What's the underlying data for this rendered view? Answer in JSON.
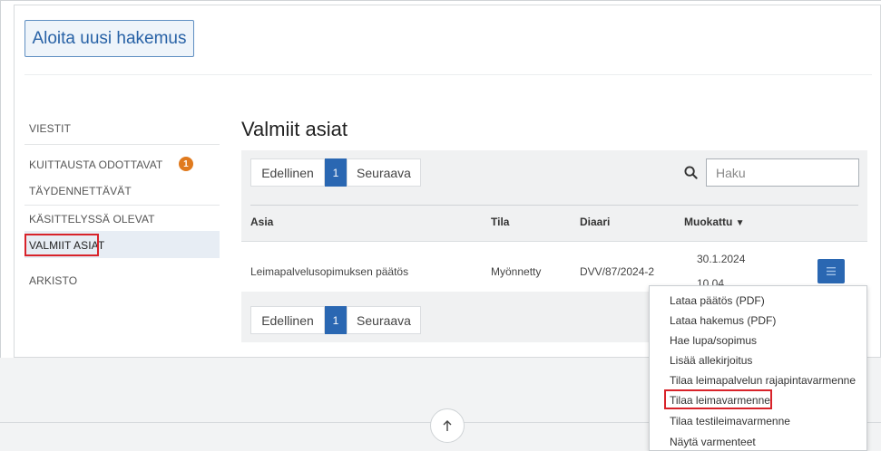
{
  "new_application_button": "Aloita uusi hakemus",
  "sidebar": {
    "items": [
      {
        "label": "VIESTIT"
      },
      {
        "label": "KUITTAUSTA ODOTTAVAT",
        "badge": "1"
      },
      {
        "label": "TÄYDENNETTÄVÄT"
      },
      {
        "label": "KÄSITTELYSSÄ OLEVAT"
      },
      {
        "label": "VALMIIT ASIAT",
        "active": true
      },
      {
        "label": "ARKISTO"
      }
    ]
  },
  "section_title": "Valmiit asiat",
  "pager": {
    "previous": "Edellinen",
    "current": "1",
    "next": "Seuraava"
  },
  "search": {
    "placeholder": "Haku",
    "icon": "search-icon"
  },
  "table": {
    "headers": {
      "asia": "Asia",
      "tila": "Tila",
      "diaari": "Diaari",
      "muokattu": "Muokattu"
    },
    "sort_indicator": "▼",
    "rows": [
      {
        "asia": "Leimapalvelusopimuksen päätös",
        "tila": "Myönnetty",
        "diaari": "DVV/87/2024-2",
        "date": "30.1.2024",
        "time": "10.04"
      }
    ]
  },
  "action_menu": {
    "icon": "hamburger-menu-icon",
    "items": [
      "Lataa päätös (PDF)",
      "Lataa hakemus (PDF)",
      "Hae lupa/sopimus",
      "Lisää allekirjoitus",
      "Tilaa leimapalvelun rajapintavarmenne",
      "Tilaa leimavarmenne",
      "Tilaa testileimavarmenne",
      "Näytä varmenteet"
    ],
    "highlighted_index": 5
  },
  "colors": {
    "accent": "#2a67b2",
    "badge": "#e07a1e",
    "highlight_box": "#d8232a"
  }
}
